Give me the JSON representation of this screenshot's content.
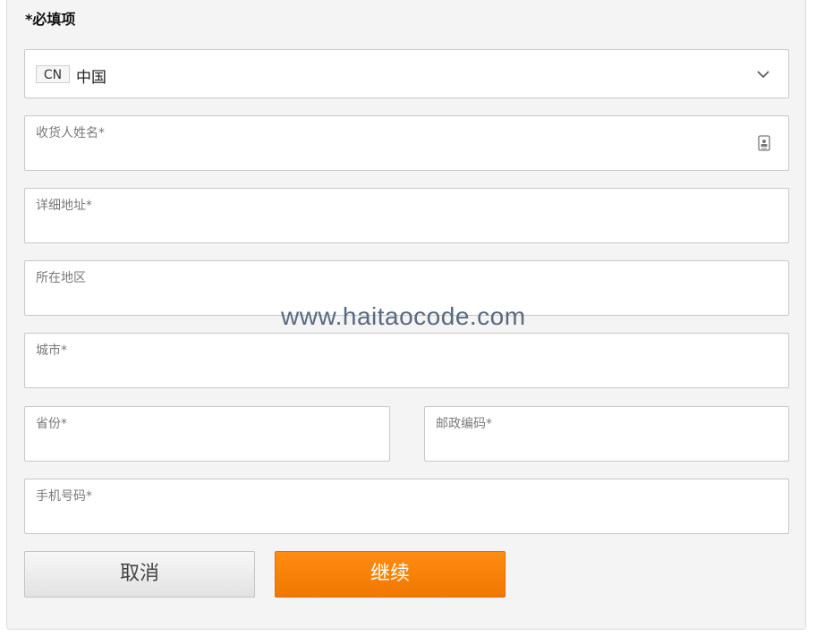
{
  "form": {
    "required_note": "*必填项",
    "country": {
      "code": "CN",
      "name": "中国"
    },
    "fields": {
      "recipient_name": {
        "label": "收货人姓名*",
        "value": ""
      },
      "address": {
        "label": "详细地址*",
        "value": ""
      },
      "district": {
        "label": "所在地区",
        "value": ""
      },
      "city": {
        "label": "城市*",
        "value": ""
      },
      "province": {
        "label": "省份*",
        "value": ""
      },
      "postal_code": {
        "label": "邮政编码*",
        "value": ""
      },
      "phone": {
        "label": "手机号码*",
        "value": ""
      }
    },
    "buttons": {
      "cancel": "取消",
      "continue": "继续"
    }
  },
  "watermark": "www.haitaocode.com",
  "icons": {
    "dropdown": "chevron-down-icon",
    "contact": "contact-card-icon"
  },
  "colors": {
    "accent": "#f58200",
    "panel_bg": "#f4f4f4",
    "label": "#7a7a7a"
  }
}
